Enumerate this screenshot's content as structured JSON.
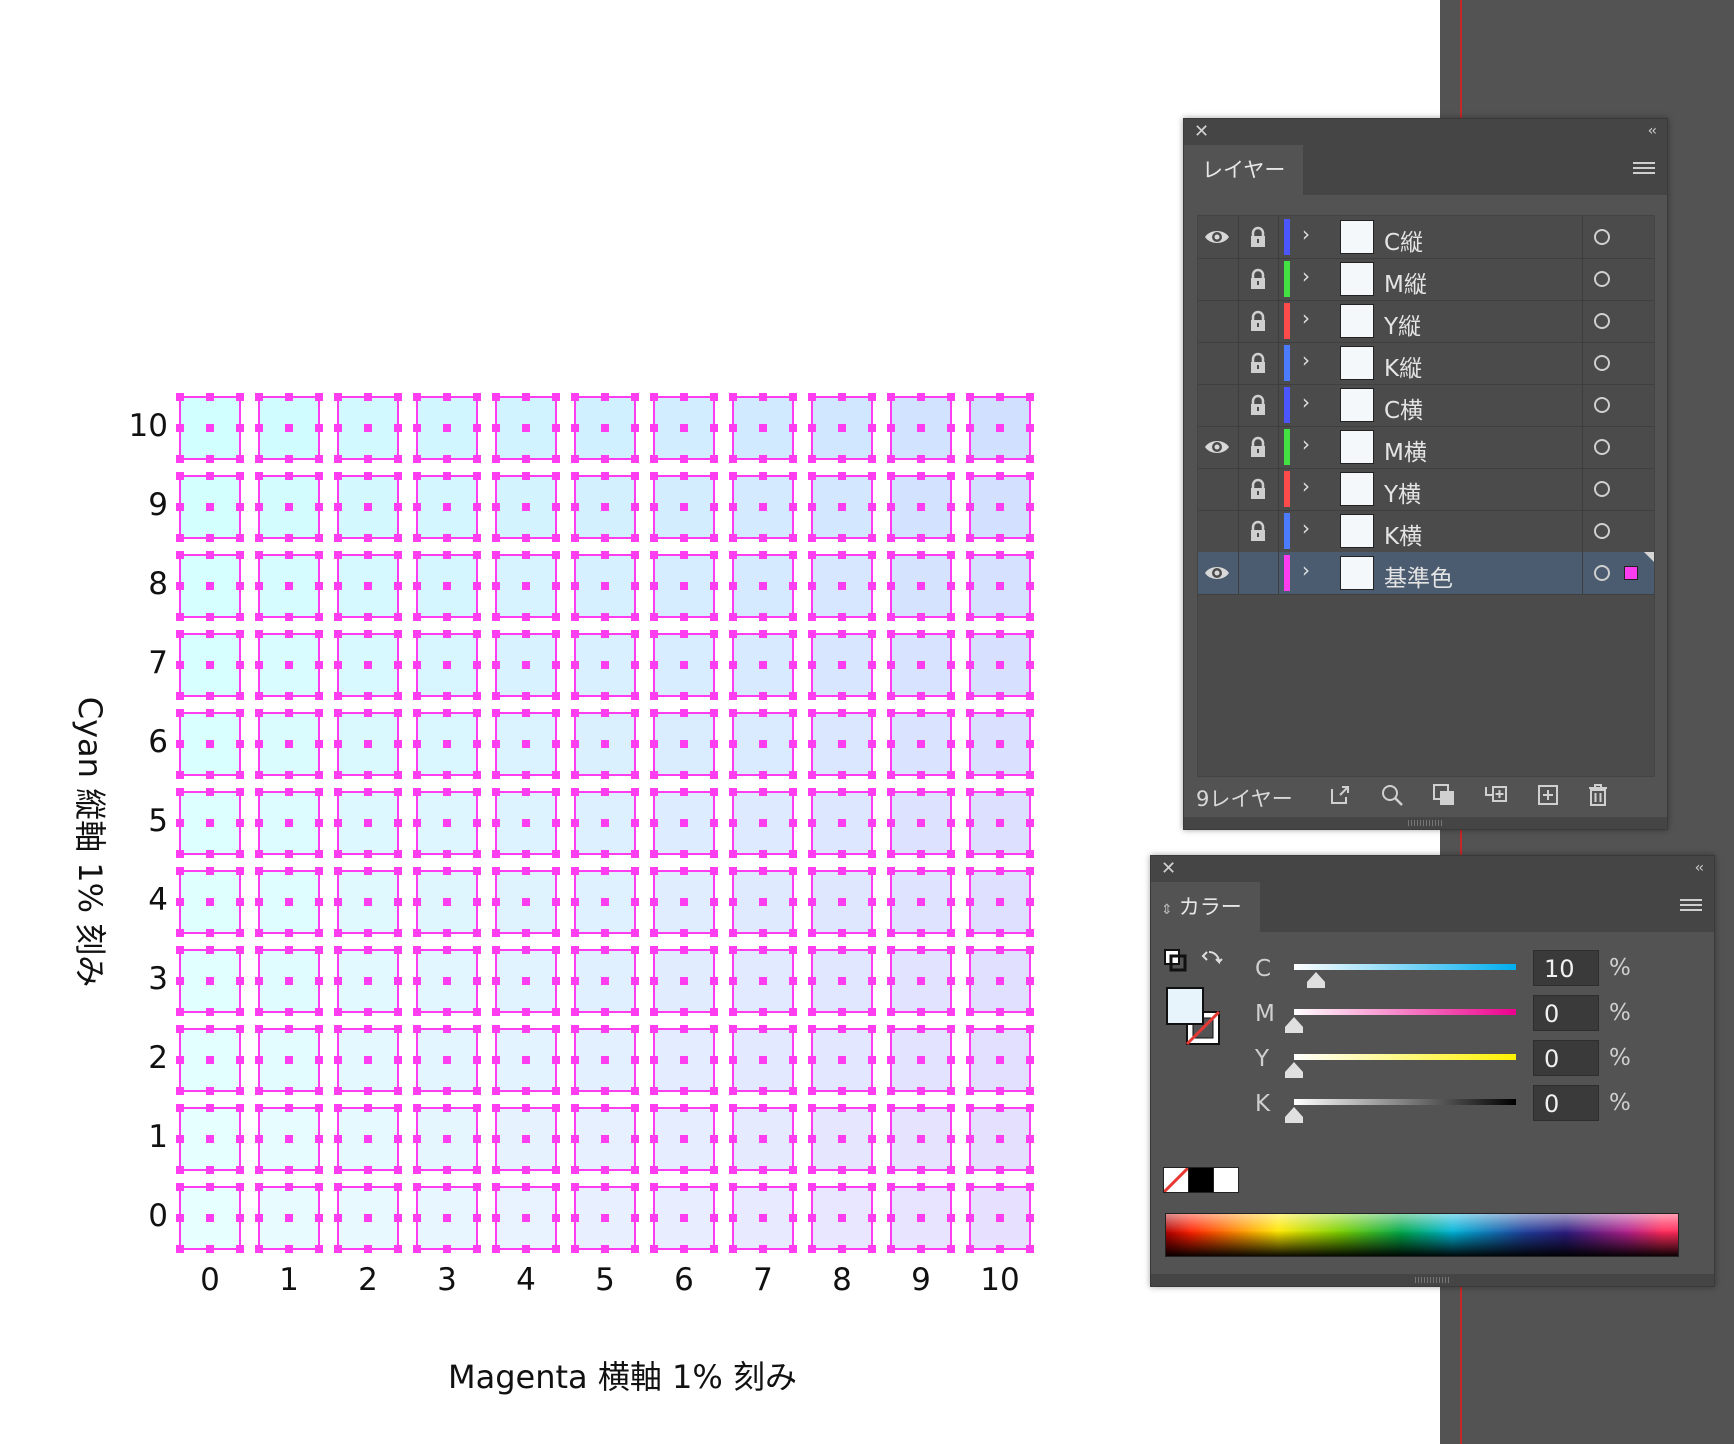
{
  "chart_data": {
    "type": "heatmap",
    "x_ticks": [
      "0",
      "1",
      "2",
      "3",
      "4",
      "5",
      "6",
      "7",
      "8",
      "9",
      "10"
    ],
    "y_ticks": [
      "0",
      "1",
      "2",
      "3",
      "4",
      "5",
      "6",
      "7",
      "8",
      "9",
      "10"
    ],
    "xlabel": "Magenta 横軸 1% 刻み",
    "ylabel": "Cyan 縦軸 1% 刻み",
    "cell_color_model": "CMYK",
    "base_cyan_percent": 10,
    "cells_note_x": "magenta % added per column 0–10",
    "cells_note_y": "cyan % added per row 0–10",
    "selection_color": "#ff3df0"
  },
  "layers_panel": {
    "tab_label": "レイヤー",
    "layers": [
      {
        "name": "C縦",
        "visible": true,
        "locked": true,
        "color": "#4b56ff"
      },
      {
        "name": "M縦",
        "visible": false,
        "locked": true,
        "color": "#43e043"
      },
      {
        "name": "Y縦",
        "visible": false,
        "locked": true,
        "color": "#ff4b4b"
      },
      {
        "name": "K縦",
        "visible": false,
        "locked": true,
        "color": "#4b7bff"
      },
      {
        "name": "C横",
        "visible": false,
        "locked": true,
        "color": "#4b56ff"
      },
      {
        "name": "M横",
        "visible": true,
        "locked": true,
        "color": "#43e043"
      },
      {
        "name": "Y横",
        "visible": false,
        "locked": true,
        "color": "#ff4b4b"
      },
      {
        "name": "K横",
        "visible": false,
        "locked": true,
        "color": "#4b7bff"
      },
      {
        "name": "基準色",
        "visible": true,
        "locked": false,
        "color": "#ff3df0",
        "selected": true
      }
    ],
    "footer_count": "9レイヤー",
    "footer_icons": [
      "export-icon",
      "search-icon",
      "clipping-mask-icon",
      "new-sublayer-icon",
      "new-layer-icon",
      "trash-icon"
    ]
  },
  "color_panel": {
    "tab_label": "カラー",
    "channels": [
      {
        "label": "C",
        "value": "10",
        "unit": "%"
      },
      {
        "label": "M",
        "value": "0",
        "unit": "%"
      },
      {
        "label": "Y",
        "value": "0",
        "unit": "%"
      },
      {
        "label": "K",
        "value": "0",
        "unit": "%"
      }
    ],
    "fill_color": "#e8f4fb"
  }
}
